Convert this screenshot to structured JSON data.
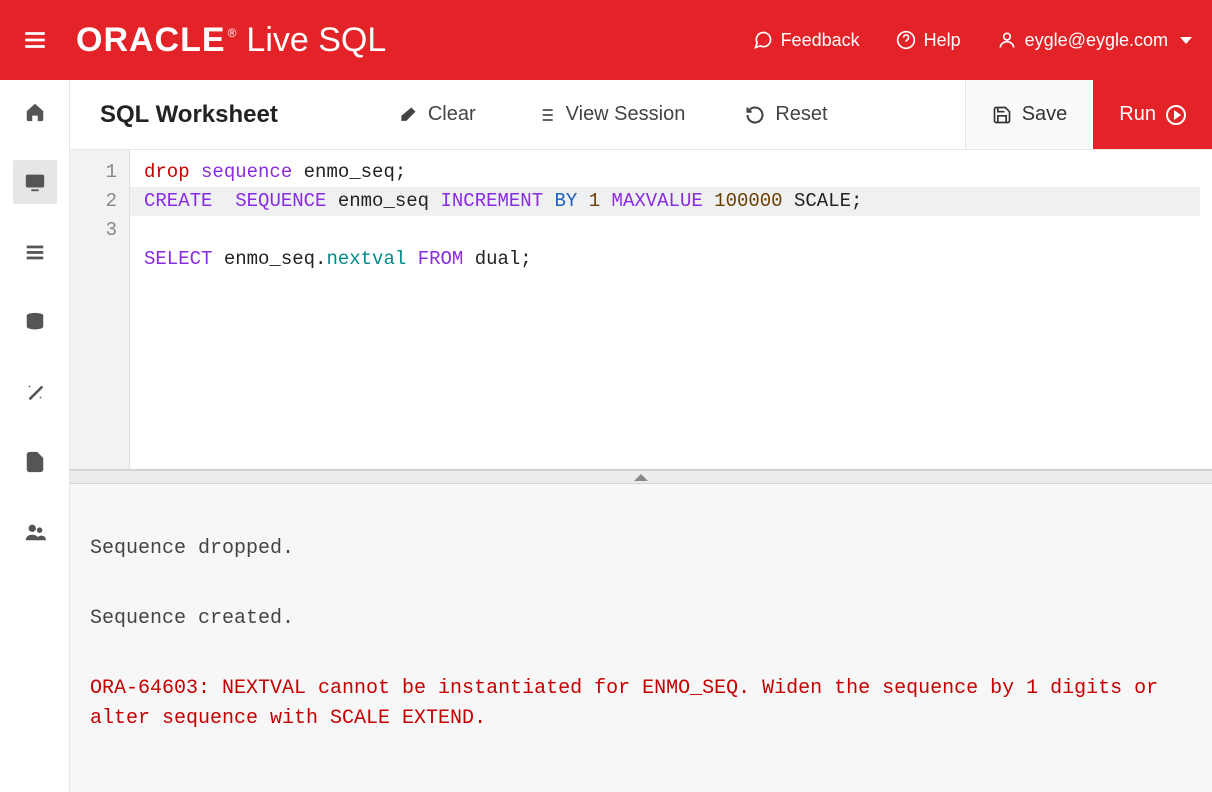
{
  "header": {
    "brand_main": "ORACLE",
    "brand_reg": "®",
    "brand_sub": "Live SQL",
    "feedback": "Feedback",
    "help": "Help",
    "user": "eygle@eygle.com"
  },
  "sidebar": {
    "items": [
      {
        "name": "home-icon"
      },
      {
        "name": "monitor-icon"
      },
      {
        "name": "list-icon"
      },
      {
        "name": "database-icon"
      },
      {
        "name": "wand-icon"
      },
      {
        "name": "document-icon"
      },
      {
        "name": "users-icon"
      }
    ],
    "active_index": 1
  },
  "toolbar": {
    "title": "SQL Worksheet",
    "clear": "Clear",
    "view_session": "View Session",
    "reset": "Reset",
    "save": "Save",
    "run": "Run"
  },
  "editor": {
    "line_numbers": [
      "1",
      "2",
      "3"
    ],
    "highlighted_line_index": 1,
    "lines_tokens": [
      [
        {
          "t": "drop",
          "c": "kw-red"
        },
        {
          "t": " "
        },
        {
          "t": "sequence",
          "c": "kw-purple"
        },
        {
          "t": " enmo_seq;"
        }
      ],
      [
        {
          "t": "CREATE",
          "c": "kw-purple"
        },
        {
          "t": "  "
        },
        {
          "t": "SEQUENCE",
          "c": "kw-purple"
        },
        {
          "t": " enmo_seq "
        },
        {
          "t": "INCREMENT",
          "c": "kw-purple"
        },
        {
          "t": " "
        },
        {
          "t": "BY",
          "c": "kw-blue"
        },
        {
          "t": " "
        },
        {
          "t": "1",
          "c": "kw-brownnum"
        },
        {
          "t": " "
        },
        {
          "t": "MAXVALUE",
          "c": "kw-purple"
        },
        {
          "t": " "
        },
        {
          "t": "100000",
          "c": "kw-brownnum"
        },
        {
          "t": " SCALE;"
        }
      ],
      [
        {
          "t": "SELECT",
          "c": "kw-purple"
        },
        {
          "t": " enmo_seq."
        },
        {
          "t": "nextval",
          "c": "kw-teal"
        },
        {
          "t": " "
        },
        {
          "t": "FROM",
          "c": "kw-purple"
        },
        {
          "t": " dual;"
        }
      ]
    ]
  },
  "results": {
    "messages": [
      {
        "text": "Sequence dropped.",
        "error": false
      },
      {
        "text": "Sequence created.",
        "error": false
      },
      {
        "text": "ORA-64603: NEXTVAL cannot be instantiated for ENMO_SEQ. Widen the sequence by 1 digits or alter sequence with SCALE EXTEND.",
        "error": true
      }
    ]
  }
}
